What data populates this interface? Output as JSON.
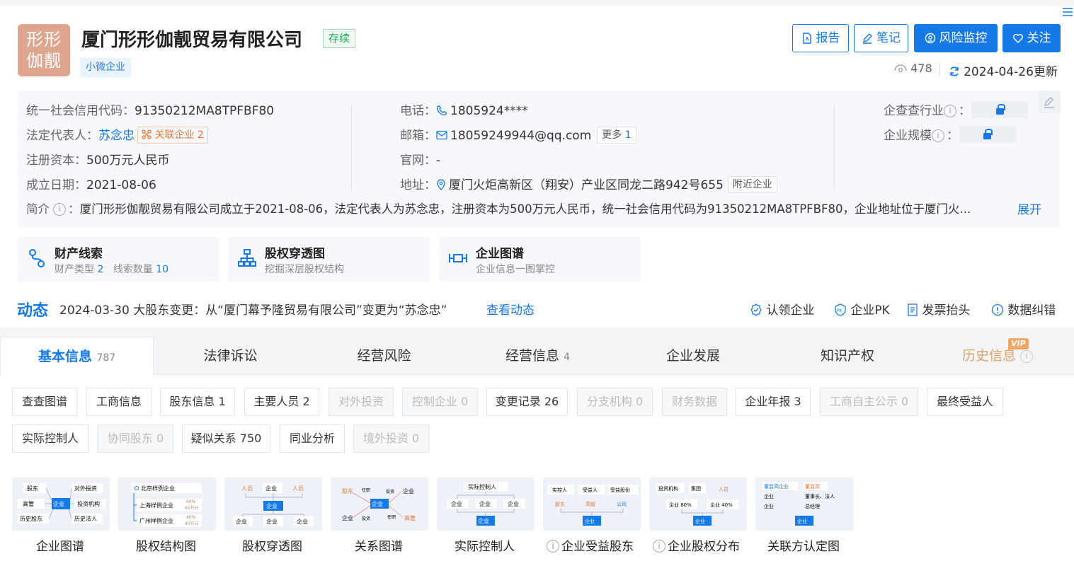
{
  "company": {
    "logo_text": "形形伽靓",
    "name": "厦门形形伽靓贸易有限公司",
    "status": "存续",
    "scale_tag": "小微企业"
  },
  "actions": {
    "report": "报告",
    "note": "笔记",
    "monitor": "风险监控",
    "follow": "关注"
  },
  "meta": {
    "views": "478",
    "updated": "2024-04-26更新"
  },
  "info": {
    "credit_label": "统一社会信用代码：",
    "credit_value": "91350212MA8TPFBF80",
    "legal_label": "法定代表人：",
    "legal_value": "苏念忠",
    "related_label": "关联企业",
    "related_count": "2",
    "capital_label": "注册资本：",
    "capital_value": "500万元人民币",
    "founded_label": "成立日期：",
    "founded_value": "2021-08-06",
    "phone_label": "电话：",
    "phone_value": "1805924****",
    "email_label": "邮箱：",
    "email_value": "18059249944@qq.com",
    "more_label": "更多",
    "more_count": "1",
    "website_label": "官网：",
    "website_value": "-",
    "address_label": "地址：",
    "address_value": "厦门火炬高新区（翔安）产业区同龙二路942号655",
    "nearby_label": "附近企业",
    "industry_label": "企查查行业",
    "size_label": "企业规模",
    "intro_label": "简介",
    "intro_value": "厦门形形伽靓贸易有限公司成立于2021-08-06，法定代表人为苏念忠，注册资本为500万元人民币，统一社会信用代码为91350212MA8TPFBF80，企业地址位于厦门火...",
    "expand": "展开"
  },
  "cards": [
    {
      "title": "财产线索",
      "sub1": "财产类型",
      "n1": "2",
      "sub2": "线索数量",
      "n2": "10"
    },
    {
      "title": "股权穿透图",
      "sub": "挖掘深层股权结构"
    },
    {
      "title": "企业图谱",
      "sub": "企业信息一图掌控"
    }
  ],
  "dynamic": {
    "label": "动态",
    "text": "2024-03-30 大股东变更：从“厦门幕予隆贸易有限公司”变更为“苏念忠”",
    "link": "查看动态",
    "claim": "认领企业",
    "pk": "企业PK",
    "invoice": "发票抬头",
    "correction": "数据纠错"
  },
  "tabs": [
    {
      "label": "基本信息",
      "count": "787"
    },
    {
      "label": "法律诉讼",
      "count": ""
    },
    {
      "label": "经营风险",
      "count": ""
    },
    {
      "label": "经营信息",
      "count": "4"
    },
    {
      "label": "企业发展",
      "count": ""
    },
    {
      "label": "知识产权",
      "count": ""
    },
    {
      "label": "历史信息",
      "count": "",
      "badge": "VIP"
    }
  ],
  "subtabs": [
    "查查图谱",
    "工商信息",
    "股东信息 1",
    "主要人员 2",
    "对外投资",
    "控制企业 0",
    "变更记录 26",
    "分支机构 0",
    "财务数据",
    "企业年报 3",
    "工商自主公示 0",
    "最终受益人",
    "实际控制人",
    "协同股东 0",
    "疑似关系 750",
    "同业分析",
    "境外投资 0"
  ],
  "thumbs": [
    {
      "label": "企业图谱",
      "words": [
        "股东",
        "对外投资",
        "高管",
        "企业",
        "投资机构",
        "历史股东",
        "历史法人"
      ]
    },
    {
      "label": "股权结构图",
      "words": [
        "北京样例企业",
        "上海样例企业",
        "60%",
        "60万元",
        "广州样例企业",
        "40%",
        "40万元"
      ]
    },
    {
      "label": "股权穿透图",
      "words": [
        "人员",
        "企业",
        "人员",
        "企业",
        "企业",
        "企业",
        "企业"
      ]
    },
    {
      "label": "关系图谱",
      "words": [
        "股东",
        "任职",
        "投资",
        "企业",
        "企业",
        "投资",
        "任职",
        "高管",
        "企业"
      ]
    },
    {
      "label": "实际控制人",
      "words": [
        "实际控制人",
        "企业",
        "企业",
        "企业",
        "企业"
      ]
    },
    {
      "label": "企业受益股东",
      "words": [
        "实控人",
        "受益人",
        "受益股份",
        "股东",
        "高管",
        "公司",
        "企业"
      ]
    },
    {
      "label": "企业股权分布",
      "words": [
        "投资机构",
        "集团",
        "人员",
        "企业 80%",
        "企业 40%",
        "企业"
      ]
    },
    {
      "label": "关联方认定图",
      "words": [
        "董监高企业",
        "董监高",
        "企业",
        "董事长、法人",
        "企业",
        "总经理",
        "企业"
      ]
    }
  ]
}
